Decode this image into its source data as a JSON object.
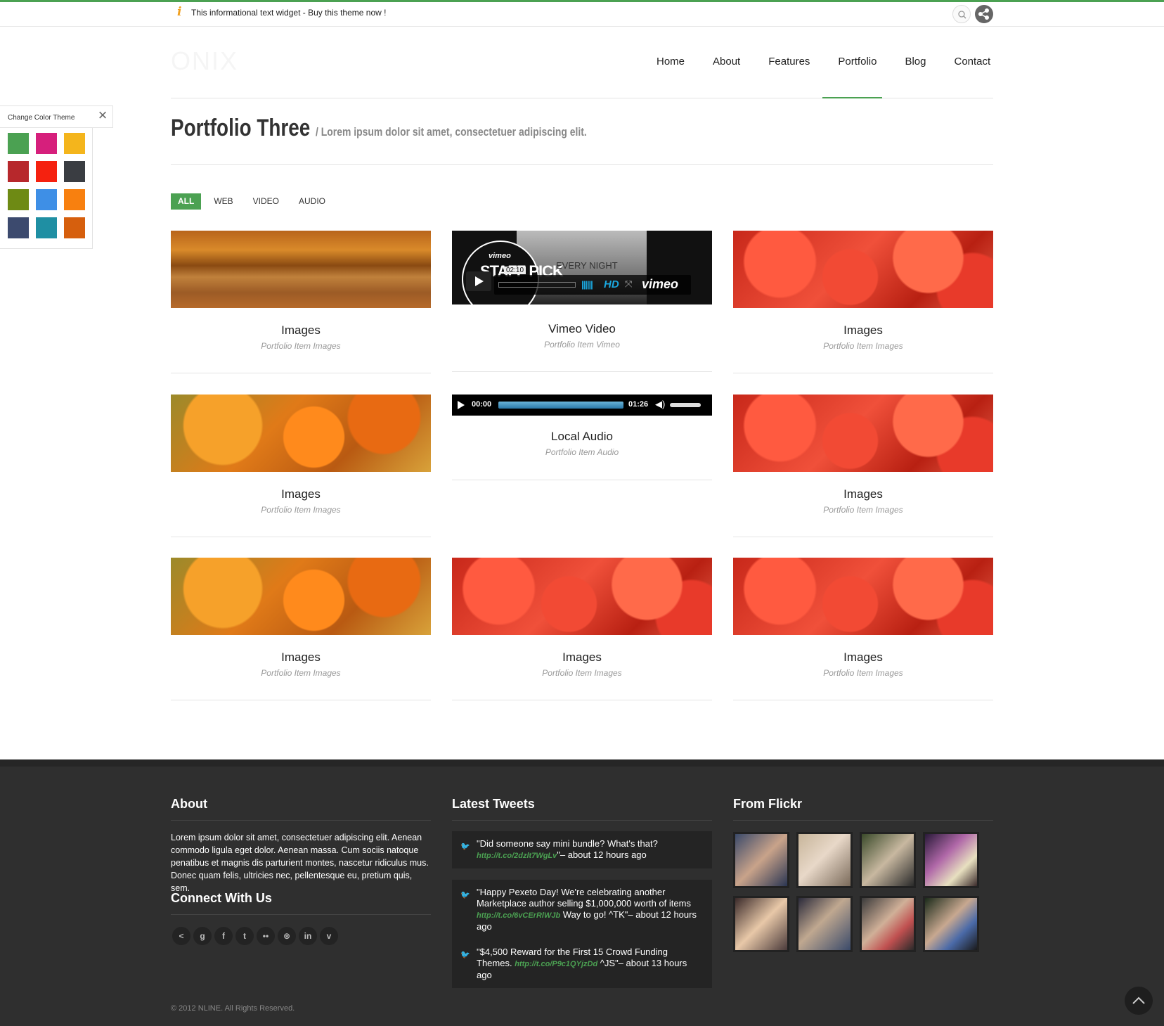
{
  "topbar": {
    "info_text": "This informational text widget - Buy this theme now !",
    "search_icon": "search-icon",
    "share_icon": "share-icon"
  },
  "logo": "ONIX",
  "nav": [
    "Home",
    "About",
    "Features",
    "Portfolio",
    "Blog",
    "Contact"
  ],
  "nav_active": "Portfolio",
  "page": {
    "title": "Portfolio Three",
    "subtitle": "/ Lorem ipsum dolor sit amet, consectetuer adipiscing elit."
  },
  "filters": [
    "ALL",
    "WEB",
    "VIDEO",
    "AUDIO"
  ],
  "filter_active": "ALL",
  "portfolio": [
    {
      "title": "Images",
      "sub": "Portfolio Item Images",
      "thumb": "autumn-path"
    },
    {
      "title": "Vimeo Video",
      "sub": "Portfolio Item Vimeo",
      "thumb": "video"
    },
    {
      "title": "Images",
      "sub": "Portfolio Item Images",
      "thumb": "red-leaves"
    },
    {
      "title": "Images",
      "sub": "Portfolio Item Images",
      "thumb": "orange-leaves"
    },
    {
      "title": "Local Audio",
      "sub": "Portfolio Item Audio",
      "thumb": "audio"
    },
    {
      "title": "Images",
      "sub": "Portfolio Item Images",
      "thumb": "red-leaves"
    },
    {
      "title": "Images",
      "sub": "Portfolio Item Images",
      "thumb": "orange-leaves"
    },
    {
      "title": "Images",
      "sub": "Portfolio Item Images",
      "thumb": "red-leaves"
    },
    {
      "title": "Images",
      "sub": "Portfolio Item Images",
      "thumb": "red-leaves"
    }
  ],
  "video": {
    "brand_top": "vimeo",
    "badge": "STAFF PICK",
    "headline": "EVERY NIGHT",
    "time": "02:10",
    "hd": "HD",
    "brand": "vimeo"
  },
  "audio": {
    "current": "00:00",
    "duration": "01:26"
  },
  "footer": {
    "about_heading": "About",
    "about_text": "Lorem ipsum dolor sit amet, consectetuer adipiscing elit. Aenean commodo ligula eget dolor. Aenean massa. Cum sociis natoque penatibus et magnis dis parturient montes, nascetur ridiculus mus. Donec quam felis, ultricies nec, pellentesque eu, pretium quis, sem.",
    "connect_heading": "Connect With Us",
    "social": [
      "share",
      "g",
      "f",
      "twitter",
      "flickr",
      "dribbble",
      "in",
      "v"
    ],
    "social_glyphs": [
      "<",
      "g",
      "f",
      "t",
      "••",
      "⊛",
      "in",
      "v"
    ],
    "tweets_heading": "Latest Tweets",
    "tweets": [
      {
        "text": "\"Did someone say mini bundle? What's that?",
        "link": "http://t.co/2dzlt7WgLv",
        "after": "\"– about 12 hours ago"
      },
      {
        "text": "\"Happy Pexeto Day! We're celebrating another Marketplace author selling $1,000,000 worth of items",
        "link": "http://t.co/6vCErRlWJb",
        "after": "Way to go! ^TK\"– about 12 hours ago"
      },
      {
        "text": "\"$4,500 Reward for the First 15 Crowd Funding Themes.",
        "link": "http://t.co/P9c1QYjzDd",
        "after": "^JS\"– about 13 hours ago"
      }
    ],
    "flickr_heading": "From Flickr",
    "copyright": "© 2012 NLINE. All Rights Reserved."
  },
  "color_panel": {
    "title": "Change Color Theme",
    "swatches": [
      "#4ba152",
      "#d61f7c",
      "#f4b51c",
      "#b7282c",
      "#f5210f",
      "#3a3d42",
      "#6e8a14",
      "#3e8fe6",
      "#f8800f",
      "#3c4a6e",
      "#1f8fa3",
      "#d65f0d"
    ]
  }
}
